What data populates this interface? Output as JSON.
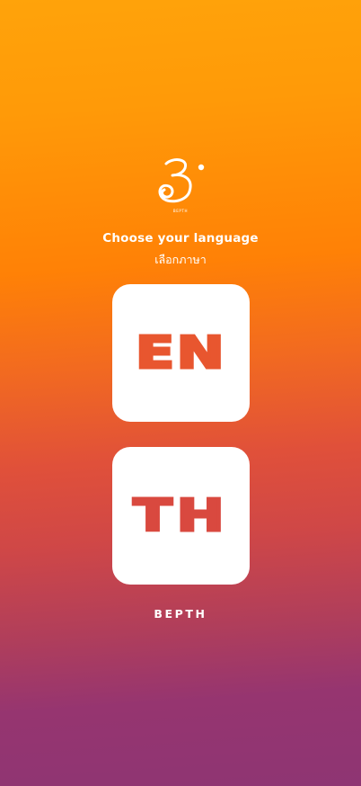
{
  "logo": {
    "icon": "bepth-logo-icon",
    "caption": "BEPTH"
  },
  "header": {
    "title_en": "Choose your language",
    "title_th": "เลือกภาษา"
  },
  "languages": [
    {
      "code": "EN"
    },
    {
      "code": "TH"
    }
  ],
  "footer": {
    "brand": "BEPTH"
  },
  "colors": {
    "gradient_top": "#ffa30a",
    "gradient_mid": "#ff8106",
    "gradient_bottom": "#8e3573",
    "card_bg": "#ffffff",
    "en_text": "#e8562f",
    "th_text": "#d9493f"
  }
}
